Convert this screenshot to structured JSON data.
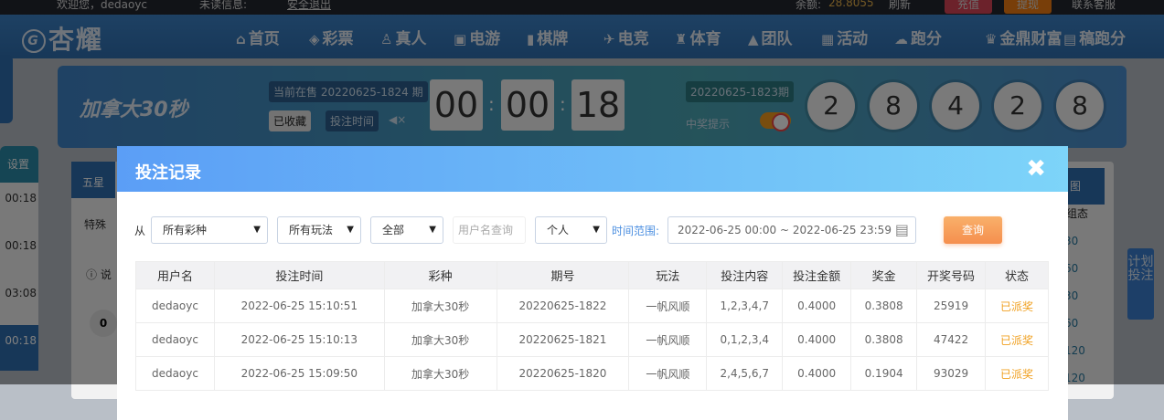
{
  "topbar": {
    "welcome": "欢迎您，dedaoyc",
    "unread": "未读信息:",
    "logout": "安全退出",
    "balance_label": "余额:",
    "balance": "28.8055",
    "refresh": "刷新",
    "recharge": "充值",
    "withdraw": "提现",
    "service": "联系客服"
  },
  "nav": {
    "logo": "杏耀",
    "items": [
      {
        "icon": "⌂",
        "label": "首页"
      },
      {
        "icon": "◈",
        "label": "彩票"
      },
      {
        "icon": "♙",
        "label": "真人"
      },
      {
        "icon": "▣",
        "label": "电游"
      },
      {
        "icon": "▮",
        "label": "棋牌"
      },
      {
        "icon": "✈",
        "label": "电竞"
      },
      {
        "icon": "♜",
        "label": "体育"
      },
      {
        "icon": "▲",
        "label": "团队"
      },
      {
        "icon": "▦",
        "label": "活动"
      },
      {
        "icon": "☁",
        "label": "跑分"
      },
      {
        "icon": "♛",
        "label": "金鼎财富"
      },
      {
        "icon": "▤",
        "label": "稿跑分"
      }
    ]
  },
  "game": {
    "name": "加拿大30秒",
    "current_issue": "当前在售 20220625-1824 期",
    "favorited": "已收藏",
    "bet_time": "投注时间",
    "countdown": [
      "00",
      "00",
      "18"
    ],
    "last_issue": "20220625-1823期",
    "win_notice": "中奖提示",
    "balls": [
      "2",
      "8",
      "4",
      "2",
      "8"
    ]
  },
  "sidebar": {
    "settings": "设置",
    "times": [
      "00:18",
      "00:18",
      "03:08",
      "00:18"
    ]
  },
  "bg": {
    "tab_five": "五星",
    "tab_special": "特殊",
    "explain": "说",
    "zero": "0",
    "chart": "图",
    "state": "组态",
    "nums": [
      "30",
      "60",
      "30",
      "60",
      "120",
      "120"
    ],
    "plan": "计划投注"
  },
  "modal": {
    "title": "投注记录",
    "from": "从",
    "filters": {
      "lottery": "所有彩种",
      "play": "所有玩法",
      "status": "全部",
      "username_placeholder": "用户名查询",
      "scope": "个人",
      "time_label": "时间范围:",
      "time_range": "2022-06-25 00:00 ~ 2022-06-25 23:59",
      "query": "查询"
    },
    "columns": [
      "用户名",
      "投注时间",
      "彩种",
      "期号",
      "玩法",
      "投注内容",
      "投注金额",
      "奖金",
      "开奖号码",
      "状态"
    ],
    "rows": [
      [
        "dedaoyc",
        "2022-06-25 15:10:51",
        "加拿大30秒",
        "20220625-1822",
        "一帆风顺",
        "1,2,3,4,7",
        "0.4000",
        "0.3808",
        "25919",
        "已派奖"
      ],
      [
        "dedaoyc",
        "2022-06-25 15:10:13",
        "加拿大30秒",
        "20220625-1821",
        "一帆风顺",
        "0,1,2,3,4",
        "0.4000",
        "0.3808",
        "47422",
        "已派奖"
      ],
      [
        "dedaoyc",
        "2022-06-25 15:09:50",
        "加拿大30秒",
        "20220625-1820",
        "一帆风顺",
        "2,4,5,6,7",
        "0.4000",
        "0.1904",
        "93029",
        "已派奖"
      ]
    ]
  }
}
